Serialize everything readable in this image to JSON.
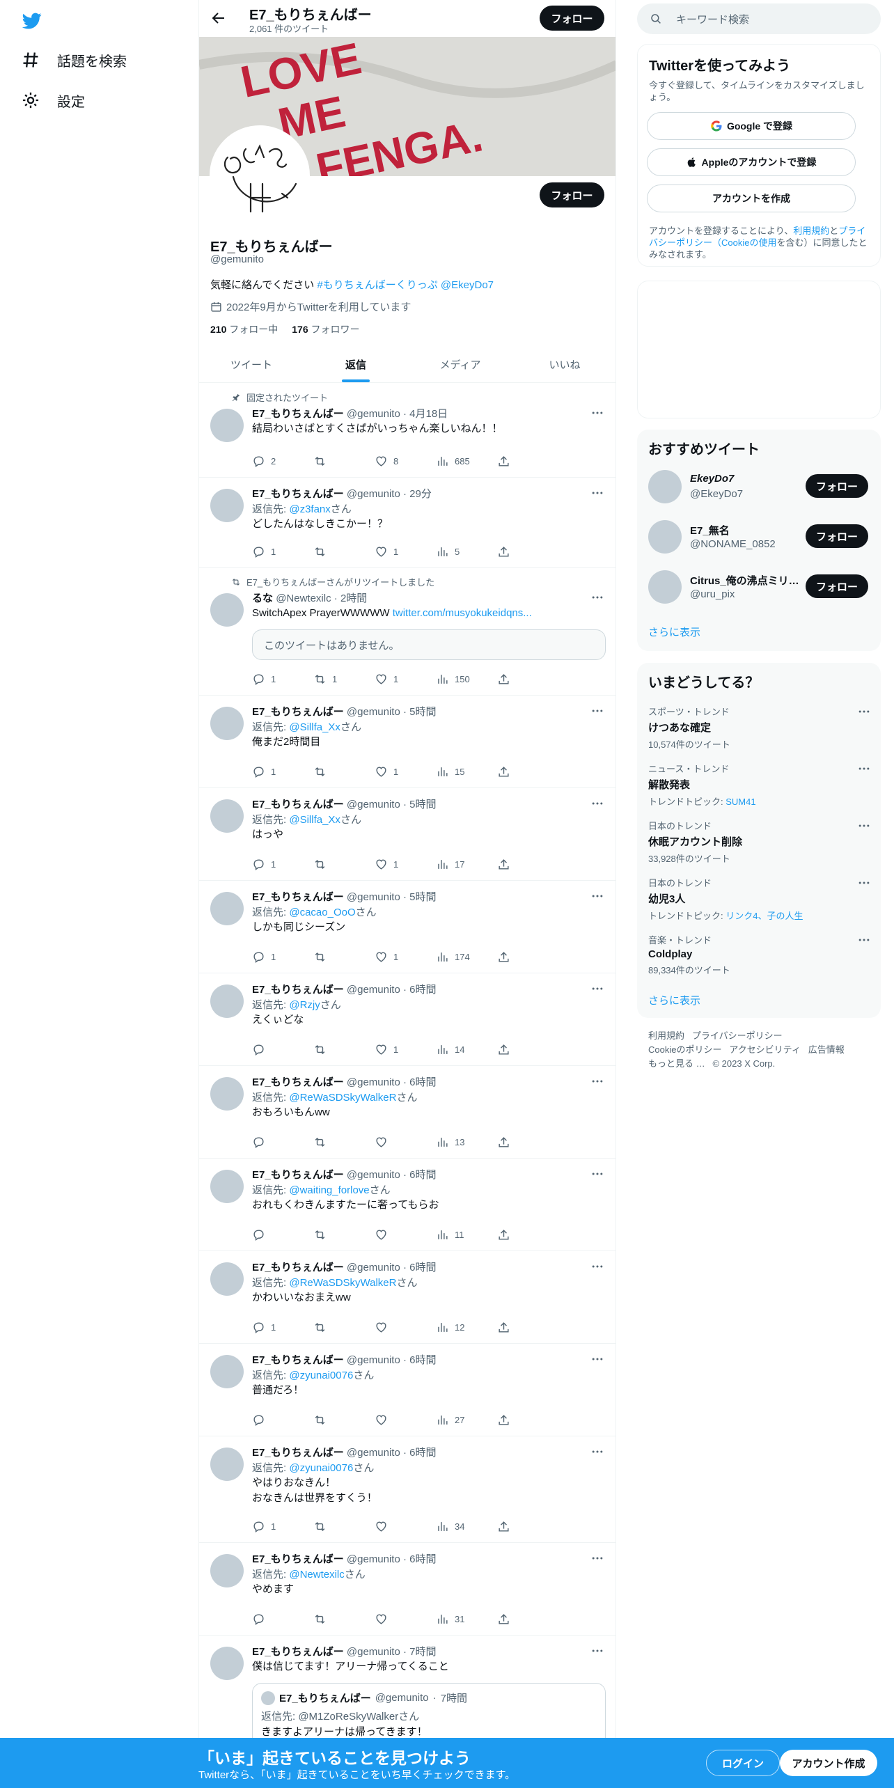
{
  "nav": {
    "logo": "twitter-bird-icon",
    "explore": "話題を検索",
    "settings": "設定"
  },
  "header": {
    "name": "E7_もりちぇんばー",
    "tweet_count": "2,061 件のツイート",
    "follow": "フォロー"
  },
  "banner": {
    "text": "LOVE ME FENGA."
  },
  "profile": {
    "name": "E7_もりちぇんばー",
    "handle": "@gemunito",
    "bio_prefix": "気軽に絡んでください ",
    "bio_hashtag": "#もりちぇんばーくりっぷ",
    "bio_mention": " @EkeyDo7",
    "joined": "2022年9月からTwitterを利用しています",
    "following_count": "210",
    "following_label": "フォロー中",
    "followers_count": "176",
    "followers_label": "フォロワー",
    "follow_button": "フォロー"
  },
  "tabs": [
    "ツイート",
    "返信",
    "メディア",
    "いいね"
  ],
  "pinned_label": "固定されたツイート",
  "retweet_label": "E7_もりちぇんばーさんがリツイートしました",
  "reply_prefix": "返信先: ",
  "reply_suffix": "さん",
  "tweets": [
    {
      "name": "E7_もりちぇんばー",
      "handle": "@gemunito",
      "time": "4月18日",
      "reply_to": "",
      "text": "結局わいさばとすくさばがいっちゃん楽しいねん！！",
      "reply": "2",
      "retweet": "",
      "like": "8",
      "views": "685"
    },
    {
      "name": "E7_もりちぇんばー",
      "handle": "@gemunito",
      "time": "29分",
      "reply_to": "@z3fanx",
      "text": "どしたんはなしきこかー！？",
      "reply": "1",
      "retweet": "",
      "like": "1",
      "views": "5"
    },
    {
      "name": "るな",
      "handle": "@Newtexilc",
      "time": "2時間",
      "reply_to": "",
      "text": "SwitchApex PrayerWWWWW ",
      "link": "twitter.com/musyokukeidqns...",
      "quote_unavailable": "このツイートはありません。",
      "reply": "1",
      "retweet": "1",
      "like": "1",
      "views": "150"
    },
    {
      "name": "E7_もりちぇんばー",
      "handle": "@gemunito",
      "time": "5時間",
      "reply_to": "@Sillfa_Xx",
      "text": "俺まだ2時間目",
      "reply": "1",
      "retweet": "",
      "like": "1",
      "views": "15"
    },
    {
      "name": "E7_もりちぇんばー",
      "handle": "@gemunito",
      "time": "5時間",
      "reply_to": "@Sillfa_Xx",
      "text": "はっや",
      "reply": "1",
      "retweet": "",
      "like": "1",
      "views": "17"
    },
    {
      "name": "E7_もりちぇんばー",
      "handle": "@gemunito",
      "time": "5時間",
      "reply_to": "@cacao_OoO",
      "text": "しかも同じシーズン",
      "reply": "1",
      "retweet": "",
      "like": "1",
      "views": "174"
    },
    {
      "name": "E7_もりちぇんばー",
      "handle": "@gemunito",
      "time": "6時間",
      "reply_to": "@Rzjy",
      "text": "えくぃどな",
      "reply": "",
      "retweet": "",
      "like": "1",
      "views": "14"
    },
    {
      "name": "E7_もりちぇんばー",
      "handle": "@gemunito",
      "time": "6時間",
      "reply_to": "@ReWaSDSkyWalkeR",
      "text": "おもろいもんww",
      "reply": "",
      "retweet": "",
      "like": "",
      "views": "13"
    },
    {
      "name": "E7_もりちぇんばー",
      "handle": "@gemunito",
      "time": "6時間",
      "reply_to": "@waiting_forlove",
      "text": "おれもくわきんますたーに奢ってもらお",
      "reply": "",
      "retweet": "",
      "like": "",
      "views": "11"
    },
    {
      "name": "E7_もりちぇんばー",
      "handle": "@gemunito",
      "time": "6時間",
      "reply_to": "@ReWaSDSkyWalkeR",
      "text": "かわいいなおまえww",
      "reply": "1",
      "retweet": "",
      "like": "",
      "views": "12"
    },
    {
      "name": "E7_もりちぇんばー",
      "handle": "@gemunito",
      "time": "6時間",
      "reply_to": "@zyunai0076",
      "text": "普通だろ！",
      "reply": "",
      "retweet": "",
      "like": "",
      "views": "27"
    },
    {
      "name": "E7_もりちぇんばー",
      "handle": "@gemunito",
      "time": "6時間",
      "reply_to": "@zyunai0076",
      "text": "やはりおなきん！\nおなきんは世界をすくう！",
      "reply": "1",
      "retweet": "",
      "like": "",
      "views": "34"
    },
    {
      "name": "E7_もりちぇんばー",
      "handle": "@gemunito",
      "time": "6時間",
      "reply_to": "@Newtexilc",
      "text": "やめます",
      "reply": "",
      "retweet": "",
      "like": "",
      "views": "31"
    },
    {
      "name": "E7_もりちぇんばー",
      "handle": "@gemunito",
      "time": "7時間",
      "reply_to": "",
      "text": "僕は信じてます！アリーナ帰ってくること",
      "quote": {
        "name": "E7_もりちぇんばー",
        "handle": "@gemunito",
        "time": "7時間",
        "reply_line": "返信先: @M1ZoReSkyWalkerさん",
        "text": "きますよアリーナは帰ってきます！"
      }
    }
  ],
  "right": {
    "search_placeholder": "キーワード検索",
    "signup_title": "Twitterを使ってみよう",
    "signup_sub": "今すぐ登録して、タイムラインをカスタマイズしましょう。",
    "google": "Google で登録",
    "apple": "Appleのアカウントで登録",
    "create": "アカウントを作成",
    "terms_1": "アカウントを登録することにより、",
    "terms_link1": "利用規約",
    "terms_2": "と",
    "terms_link2": "プライバシーポリシー（Cookieの使用",
    "terms_3": "を含む）に同意したとみなされます。",
    "rec_title": "おすすめツイート",
    "recs": [
      {
        "name": "EkeyDo7",
        "handle": "@EkeyDo7",
        "follow": "フォロー"
      },
      {
        "name": "E7_無名",
        "handle": "@NONAME_0852",
        "follow": "フォロー"
      },
      {
        "name": "Citrus_俺の沸点ミリ…",
        "handle": "@uru_pix",
        "follow": "フォロー"
      }
    ],
    "show_more": "さらに表示",
    "trends_title": "いまどうしてる？",
    "trends": [
      {
        "cat": "スポーツ・トレンド",
        "name": "けつあな確定",
        "count": "10,574件のツイート"
      },
      {
        "cat": "ニュース・トレンド",
        "name": "解散発表",
        "count_prefix": "トレンドトピック: ",
        "count_link": "SUM41"
      },
      {
        "cat": "日本のトレンド",
        "name": "休眠アカウント削除",
        "count": "33,928件のツイート"
      },
      {
        "cat": "日本のトレンド",
        "name": "幼児3人",
        "count_prefix": "トレンドトピック: ",
        "count_link": "リンク4、子の人生"
      },
      {
        "cat": "音楽・トレンド",
        "name": "Coldplay",
        "count": "89,334件のツイート"
      }
    ],
    "trends_more": "さらに表示",
    "footer": [
      "利用規約",
      "プライバシーポリシー",
      "Cookieのポリシー",
      "アクセシビリティ",
      "広告情報",
      "もっと見る …",
      "© 2023 X Corp."
    ]
  },
  "bottom": {
    "title": "「いま」起きていることを見つけよう",
    "sub": "Twitterなら、「いま」起きていることをいち早くチェックできます。",
    "login": "ログイン",
    "signup": "アカウント作成"
  },
  "colors": {
    "accent": "#1d9bf0",
    "text": "#0f1419",
    "secondary": "#536471",
    "button": "#0f1419"
  }
}
